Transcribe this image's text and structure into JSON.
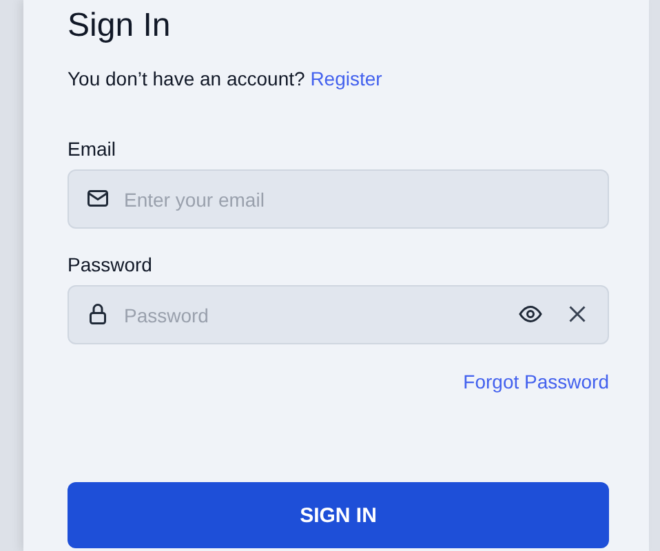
{
  "title": "Sign In",
  "register_prompt": {
    "text": "You don’t have an account?",
    "link": "Register"
  },
  "fields": [
    {
      "label": "Email",
      "placeholder": "Enter your email",
      "kind": "email"
    },
    {
      "label": "Password",
      "placeholder": "Password",
      "kind": "password"
    }
  ],
  "forgot_link": "Forgot Password",
  "submit_button": "SIGN IN"
}
